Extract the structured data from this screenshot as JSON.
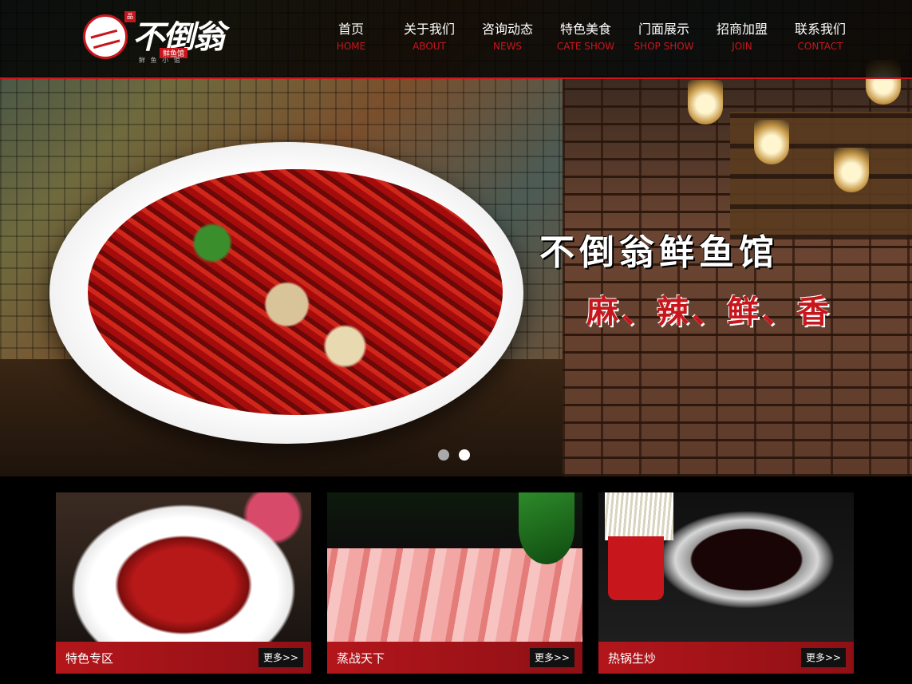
{
  "brand": {
    "name": "不倒翁",
    "tag": "鲜鱼馆",
    "seal": "品",
    "footer": "鲜 鱼 小 馆"
  },
  "nav": [
    {
      "cn": "首页",
      "en": "HOME"
    },
    {
      "cn": "关于我们",
      "en": "ABOUT"
    },
    {
      "cn": "咨询动态",
      "en": "NEWS"
    },
    {
      "cn": "特色美食",
      "en": "CATE SHOW"
    },
    {
      "cn": "门面展示",
      "en": "SHOP SHOW"
    },
    {
      "cn": "招商加盟",
      "en": "JOIN"
    },
    {
      "cn": "联系我们",
      "en": "CONTACT"
    }
  ],
  "hero": {
    "title": "不倒翁鲜鱼馆",
    "subtitle": "麻、辣、鲜、香",
    "slides": 2,
    "active_slide": 2
  },
  "cards": [
    {
      "title": "特色专区",
      "more": "更多>>"
    },
    {
      "title": "蒸战天下",
      "more": "更多>>"
    },
    {
      "title": "热锅生炒",
      "more": "更多>>"
    }
  ],
  "colors": {
    "accent": "#c8161d",
    "header_bg": "#000000",
    "card_bar": "#b3161b"
  }
}
